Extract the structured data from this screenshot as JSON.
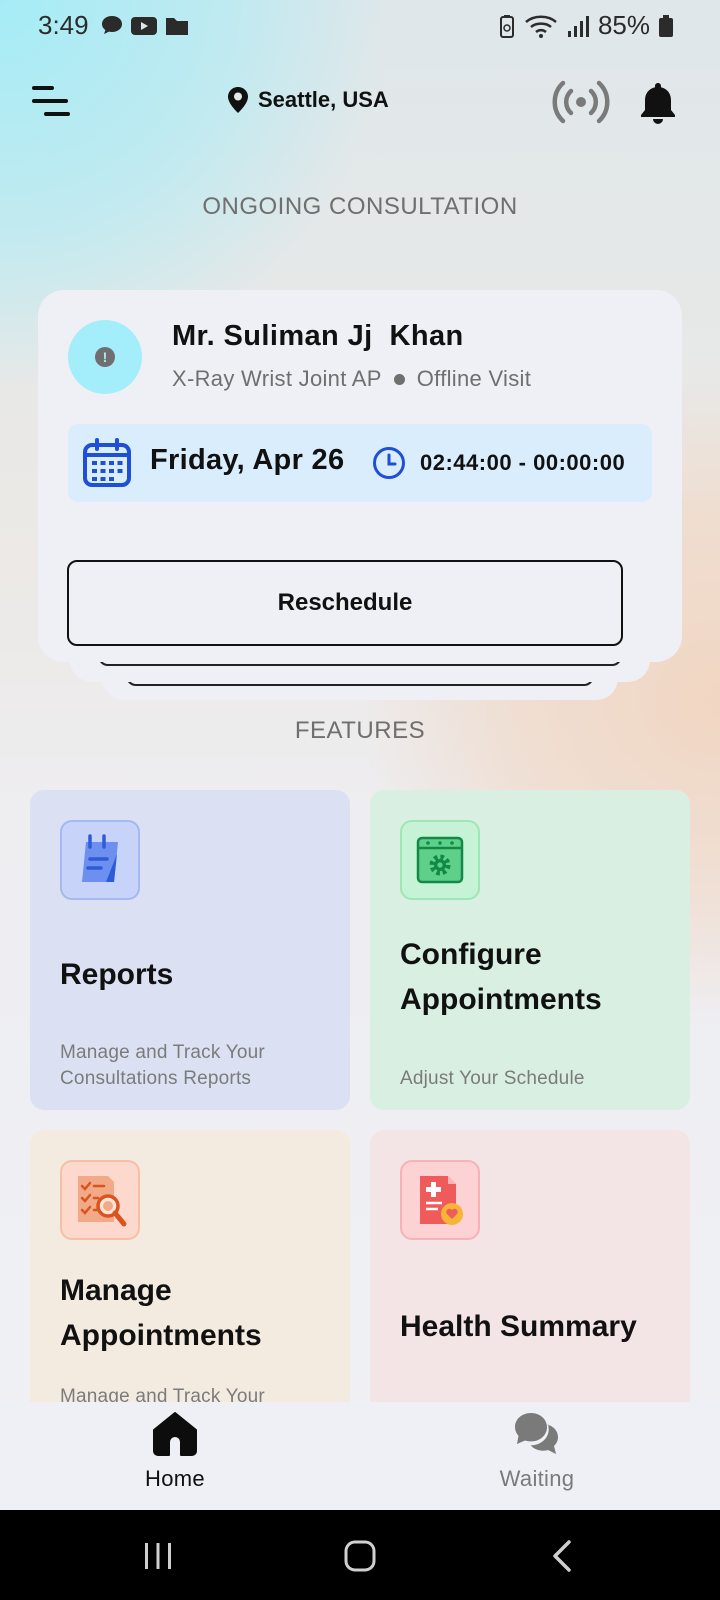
{
  "status_bar": {
    "time": "3:49",
    "battery": "85%",
    "icons": [
      "chat-bubble-icon",
      "youtube-icon",
      "folder-icon",
      "battery-saver-icon",
      "wifi-icon",
      "signal-icon",
      "battery-icon"
    ]
  },
  "header": {
    "location": "Seattle, USA",
    "icons": [
      "menu-icon",
      "location-pin-icon",
      "broadcast-icon",
      "bell-icon"
    ]
  },
  "ongoing": {
    "section_title": "ONGOING CONSULTATION",
    "patient_name": "Mr. Suliman Jj  Khan",
    "visit_type": "X-Ray Wrist Joint AP",
    "visit_mode": "Offline Visit",
    "date": "Friday, Apr 26",
    "time_range": "02:44:00 - 00:00:00",
    "reschedule_label": "Reschedule"
  },
  "features": {
    "section_title": "FEATURES",
    "items": [
      {
        "title": "Reports",
        "subtitle": "Manage and Track Your Consultations Reports",
        "icon": "report-notepad-icon",
        "color": "#dbe1f3"
      },
      {
        "title": "Configure Appointments",
        "subtitle": "Adjust Your Schedule",
        "icon": "calendar-gear-icon",
        "color": "#d9efe2"
      },
      {
        "title": "Manage Appointments",
        "subtitle": "Manage and Track Your",
        "icon": "checklist-search-icon",
        "color": "#f4ebe0"
      },
      {
        "title": "Health Summary",
        "subtitle": "",
        "icon": "medical-report-icon",
        "color": "#f3e4e5"
      }
    ]
  },
  "bottom_nav": {
    "items": [
      {
        "label": "Home",
        "icon": "home-icon",
        "active": true
      },
      {
        "label": "Waiting",
        "icon": "chat-bubbles-icon",
        "active": false
      }
    ]
  },
  "system_nav": [
    "recents-icon",
    "home-circle-icon",
    "back-icon"
  ]
}
